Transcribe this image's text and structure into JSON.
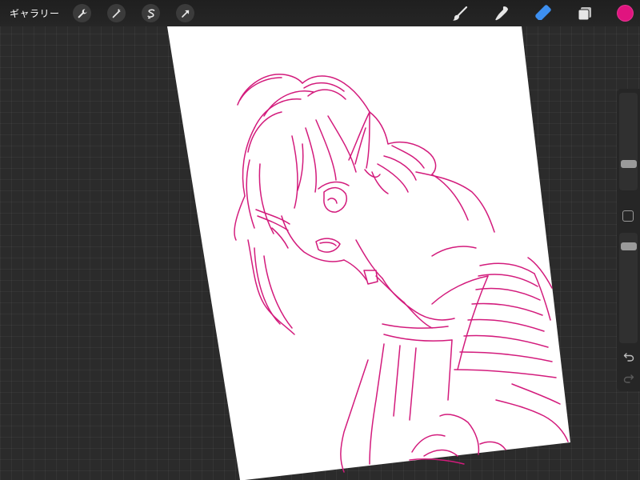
{
  "toolbar": {
    "gallery_label": "ギャラリー",
    "left_tools": [
      {
        "name": "actions",
        "icon": "wrench-icon"
      },
      {
        "name": "adjustments",
        "icon": "magic-wand-icon"
      },
      {
        "name": "selection",
        "icon": "selection-s-icon"
      },
      {
        "name": "transform",
        "icon": "transform-arrow-icon"
      }
    ],
    "right_tools": [
      {
        "name": "brush",
        "icon": "brush-icon",
        "active": false
      },
      {
        "name": "smudge",
        "icon": "smudge-icon",
        "active": false
      },
      {
        "name": "eraser",
        "icon": "eraser-icon",
        "active": true
      },
      {
        "name": "layers",
        "icon": "layers-icon",
        "active": false
      }
    ],
    "active_color": "#e0147f"
  },
  "sidebar": {
    "brush_size_slider": "brush-size",
    "opacity_slider": "opacity",
    "modify_button": "eyedropper-modify",
    "undo": "undo-icon",
    "redo": "redo-icon"
  },
  "canvas": {
    "background": "#ffffff",
    "stroke_color": "#d31b7c",
    "workspace_background": "#2b2b2b"
  }
}
